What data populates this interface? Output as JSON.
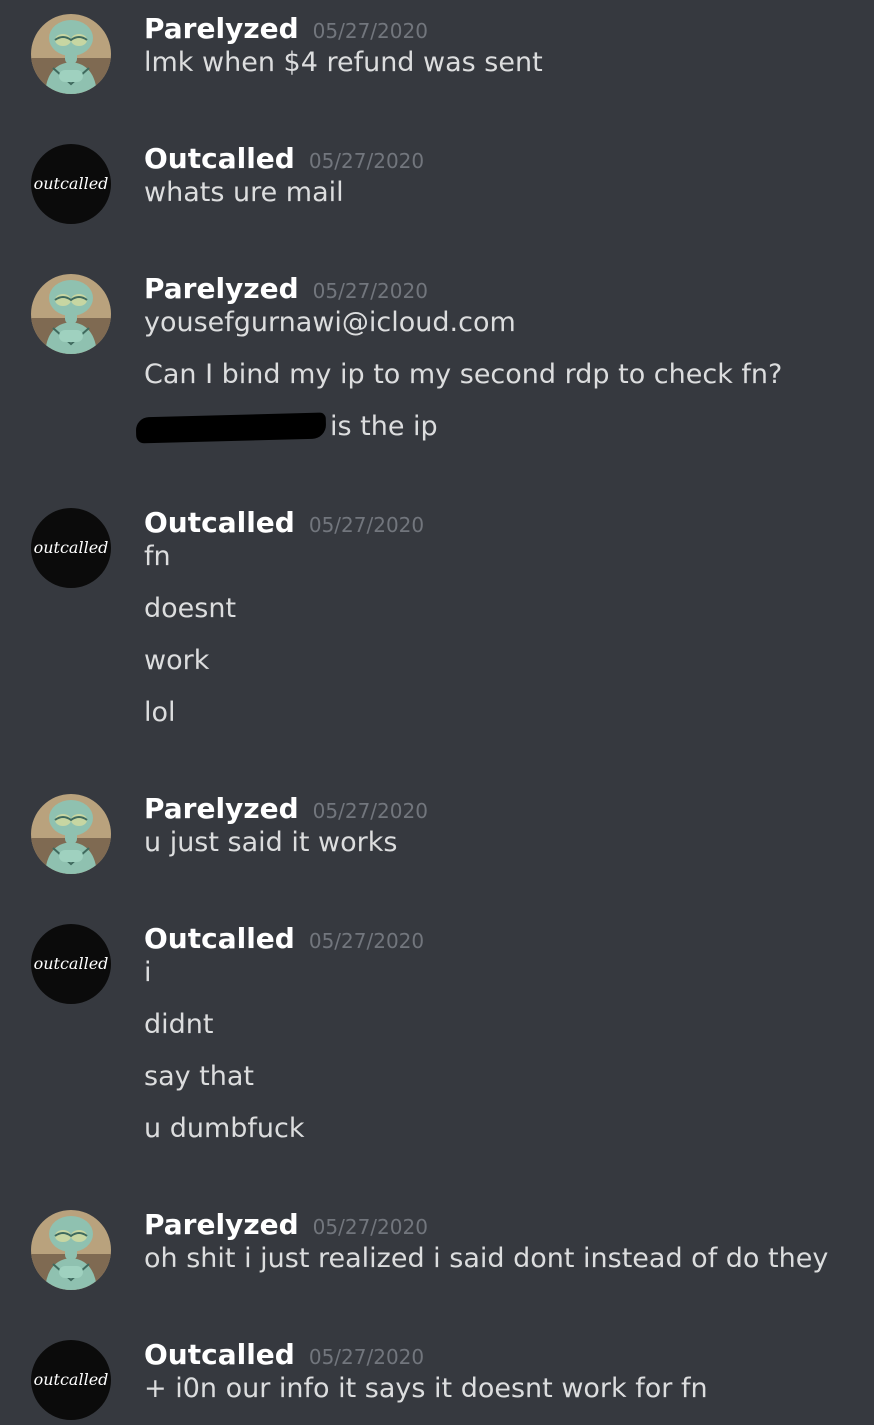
{
  "colors": {
    "background": "#36393f",
    "username": "#ffffff",
    "timestamp": "#72767d",
    "message_text": "#dcddde",
    "outcalled_avatar_bg": "#0b0b0b",
    "parelyzed_avatar_skin": "#8fc1b0"
  },
  "users": {
    "parelyzed": {
      "name": "Parelyzed",
      "avatar_icon": "squidward-avatar-icon"
    },
    "outcalled": {
      "name": "Outcalled",
      "avatar_icon": "outcalled-logo-avatar-icon",
      "avatar_text": "outcalled"
    }
  },
  "messages": [
    {
      "author": "Parelyzed",
      "timestamp": "05/27/2020",
      "lines": [
        "lmk when $4 refund was sent"
      ]
    },
    {
      "author": "Outcalled",
      "timestamp": "05/27/2020",
      "lines": [
        "whats ure mail"
      ]
    },
    {
      "author": "Parelyzed",
      "timestamp": "05/27/2020",
      "lines": [
        "yousefgurnawi@icloud.com",
        "Can I bind my ip to my second rdp to check fn?",
        "is the ip"
      ]
    },
    {
      "author": "Outcalled",
      "timestamp": "05/27/2020",
      "lines": [
        "fn",
        "doesnt",
        "work",
        "lol"
      ]
    },
    {
      "author": "Parelyzed",
      "timestamp": "05/27/2020",
      "lines": [
        "u just said it works"
      ]
    },
    {
      "author": "Outcalled",
      "timestamp": "05/27/2020",
      "lines": [
        "i",
        "didnt",
        "say that",
        "u dumbfuck"
      ]
    },
    {
      "author": "Parelyzed",
      "timestamp": "05/27/2020",
      "lines": [
        "oh shit i just realized i said dont instead of do they"
      ]
    },
    {
      "author": "Outcalled",
      "timestamp": "05/27/2020",
      "lines": [
        "+ i0n our info it says it doesnt work for fn"
      ]
    }
  ]
}
